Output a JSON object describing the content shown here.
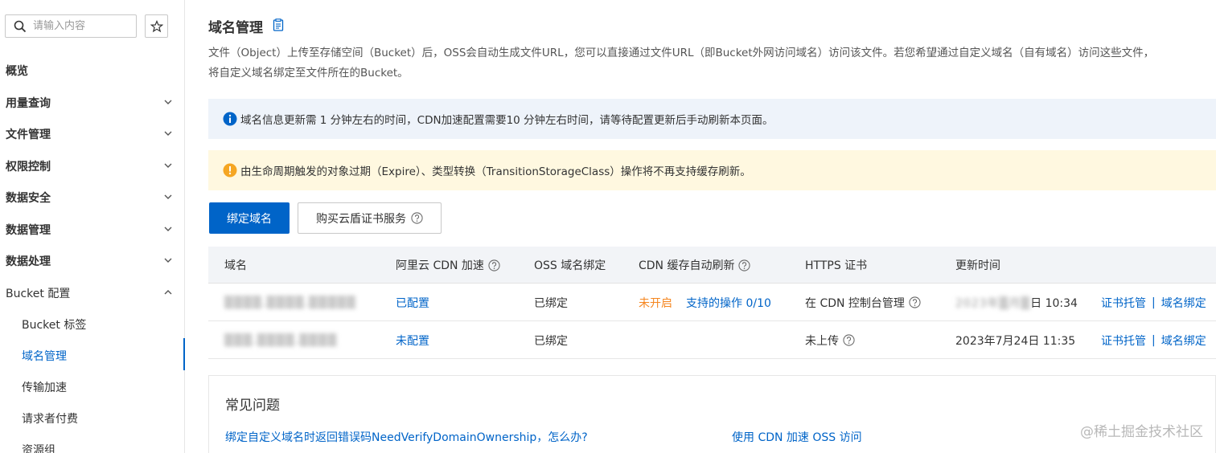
{
  "sidebar": {
    "search_placeholder": "请输入内容",
    "items": [
      {
        "label": "概览"
      },
      {
        "label": "用量查询"
      },
      {
        "label": "文件管理"
      },
      {
        "label": "权限控制"
      },
      {
        "label": "数据安全"
      },
      {
        "label": "数据管理"
      },
      {
        "label": "数据处理"
      },
      {
        "label": "Bucket 配置"
      }
    ],
    "sub_items": [
      {
        "label": "Bucket 标签"
      },
      {
        "label": "域名管理"
      },
      {
        "label": "传输加速"
      },
      {
        "label": "请求者付费"
      },
      {
        "label": "资源组"
      }
    ]
  },
  "main": {
    "title": "域名管理",
    "desc_line1": "文件（Object）上传至存储空间（Bucket）后，OSS会自动生成文件URL，您可以直接通过文件URL（即Bucket外网访问域名）访问该文件。若您希望通过自定义域名（自有域名）访问这些文件，",
    "desc_line2": "将自定义域名绑定至文件所在的Bucket。",
    "notice_info": "域名信息更新需 1 分钟左右的时间，CDN加速配置需要10 分钟左右时间，请等待配置更新后手动刷新本页面。",
    "notice_warn": "由生命周期触发的对象过期（Expire）、类型转换（TransitionStorageClass）操作将不再支持缓存刷新。",
    "btn_bind": "绑定域名",
    "btn_buy": "购买云盾证书服务"
  },
  "table": {
    "headers": {
      "domain": "域名",
      "cdn": "阿里云 CDN 加速",
      "oss_bind": "OSS 域名绑定",
      "cdn_refresh": "CDN 缓存自动刷新",
      "https": "HTTPS 证书",
      "updated": "更新时间"
    },
    "rows": [
      {
        "domain": "▒▒▒▒.▒▒▒▒.▒▒▒▒▒",
        "cdn": "已配置",
        "oss_bind": "已绑定",
        "refresh_status": "未开启",
        "refresh_ops": "支持的操作 0/10",
        "https": "在 CDN 控制台管理",
        "updated_blur": "2023年▒月▒",
        "updated": "日 10:34",
        "action1": "证书托管",
        "action2": "域名绑定"
      },
      {
        "domain": "▒▒▒.▒▒▒▒.▒▒▒▒",
        "cdn": "未配置",
        "oss_bind": "已绑定",
        "refresh_status": "",
        "refresh_ops": "",
        "https": "未上传",
        "updated_blur": "",
        "updated": "2023年7月24日 11:35",
        "action1": "证书托管",
        "action2": "域名绑定"
      }
    ],
    "action_sep": "|"
  },
  "faq": {
    "title": "常见问题",
    "q1": "绑定自定义域名时返回错误码NeedVerifyDomainOwnership，怎么办?",
    "q2": "使用 CDN 加速 OSS 访问"
  },
  "watermark": "@稀土掘金技术社区",
  "colors": {
    "primary": "#0064c8",
    "warning": "#f5861f",
    "info_bg": "#eef3fa",
    "warn_bg": "#fff8e0"
  }
}
